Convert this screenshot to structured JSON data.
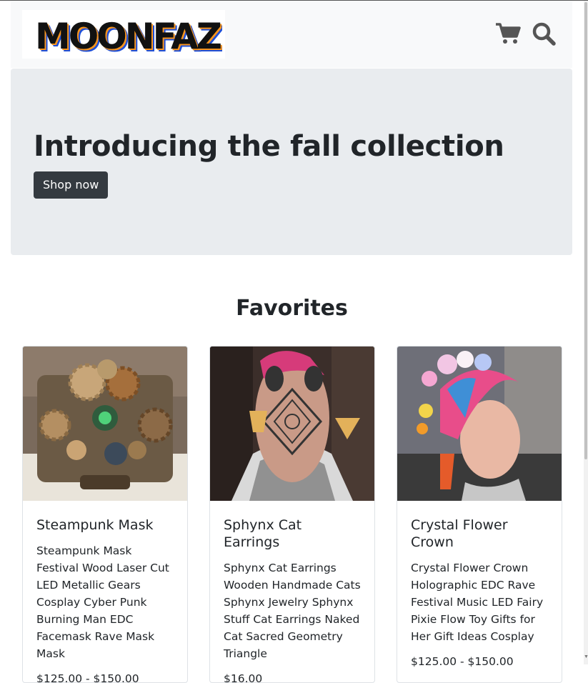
{
  "brand": {
    "logo_text": "MOONFAZED"
  },
  "header": {
    "icons": [
      "cart-icon",
      "search-icon"
    ]
  },
  "hero": {
    "headline": "Introducing the fall collection",
    "cta_label": "Shop now",
    "bg_color": "#e9ecef",
    "cta_color": "#343a40"
  },
  "favorites": {
    "title": "Favorites",
    "products": [
      {
        "name": "Steampunk Mask",
        "description": "Steampunk Mask Festival Wood Laser Cut LED Metallic Gears Cosplay Cyber Punk Burning Man EDC Facemask Rave Mask Mask",
        "price": "$125.00 - $150.00"
      },
      {
        "name": "Sphynx Cat Earrings",
        "description": "Sphynx Cat Earrings Wooden Handmade Cats Sphynx Jewelry Sphynx Stuff Cat Earrings Naked Cat Sacred Geometry Triangle",
        "price": "$16.00"
      },
      {
        "name": "Crystal Flower Crown",
        "description": "Crystal Flower Crown Holographic EDC Rave Festival Music LED Fairy Pixie Flow Toy Gifts for Her Gift Ideas Cosplay",
        "price": "$125.00 - $150.00"
      }
    ]
  }
}
